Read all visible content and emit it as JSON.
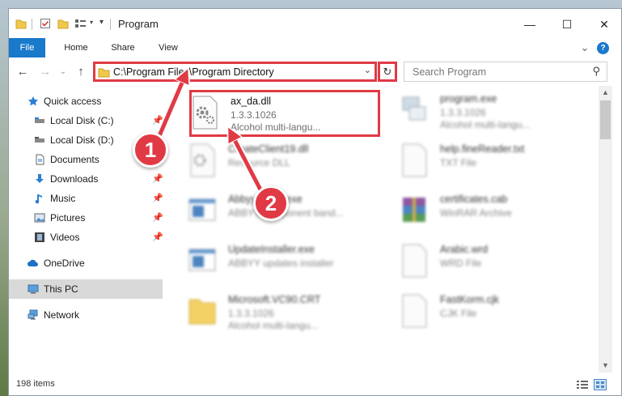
{
  "window": {
    "title": "Program",
    "minimize_glyph": "—",
    "maximize_glyph": "☐",
    "close_glyph": "✕"
  },
  "ribbon": {
    "tabs": [
      {
        "label": "File"
      },
      {
        "label": "Home"
      },
      {
        "label": "Share"
      },
      {
        "label": "View"
      }
    ],
    "expand_glyph": "⌄",
    "help_glyph": "?"
  },
  "nav": {
    "back_glyph": "←",
    "forward_glyph": "→",
    "recent_glyph": "⌄",
    "up_glyph": "↑"
  },
  "address": {
    "path": "C:\\Program Files\\Program Directory",
    "dropdown_glyph": "⌄",
    "refresh_glyph": "↻"
  },
  "search": {
    "placeholder": "Search Program",
    "icon_glyph": "⚲"
  },
  "sidebar": {
    "items": [
      {
        "label": "Quick access",
        "icon": "star-icon",
        "pinned": false
      },
      {
        "label": "Local Disk (C:)",
        "icon": "drive-icon",
        "pinned": true
      },
      {
        "label": "Local Disk (D:)",
        "icon": "drive-icon",
        "pinned": true
      },
      {
        "label": "Documents",
        "icon": "document-icon",
        "pinned": true
      },
      {
        "label": "Downloads",
        "icon": "download-icon",
        "pinned": true
      },
      {
        "label": "Music",
        "icon": "music-icon",
        "pinned": true
      },
      {
        "label": "Pictures",
        "icon": "pictures-icon",
        "pinned": true
      },
      {
        "label": "Videos",
        "icon": "video-icon",
        "pinned": true
      },
      {
        "label": "OneDrive",
        "icon": "cloud-icon",
        "pinned": false
      },
      {
        "label": "This PC",
        "icon": "computer-icon",
        "pinned": false,
        "selected": true
      },
      {
        "label": "Network",
        "icon": "network-icon",
        "pinned": false
      }
    ],
    "pin_glyph": "📌"
  },
  "files": [
    {
      "name": "ax_da.dll",
      "meta1": "1.3.3.1026",
      "meta2": "Alcohol multi-langu...",
      "icon": "dll-gear-icon",
      "highlighted": true
    },
    {
      "name": "program.exe",
      "meta1": "1.3.3.1026",
      "meta2": "Alcohol multi-langu...",
      "icon": "exe-icon"
    },
    {
      "name": "CreateClient19.dll",
      "meta1": "Resource DLL",
      "meta2": "",
      "icon": "dll-gear-icon"
    },
    {
      "name": "help.fineReader.txt",
      "meta1": "TXT File",
      "meta2": "",
      "icon": "text-file-icon"
    },
    {
      "name": "AbbyyComp.exe",
      "meta1": "ABBYY component band...",
      "meta2": "",
      "icon": "app-window-icon"
    },
    {
      "name": "certificates.cab",
      "meta1": "WinRAR Archive",
      "meta2": "",
      "icon": "winrar-icon"
    },
    {
      "name": "UpdateInstaller.exe",
      "meta1": "ABBYY updates installer",
      "meta2": "",
      "icon": "app-window-icon"
    },
    {
      "name": "Arabic.wrd",
      "meta1": "WRD File",
      "meta2": "",
      "icon": "blank-file-icon"
    },
    {
      "name": "Microsoft.VC90.CRT",
      "meta1": "1.3.3.1026",
      "meta2": "Alcohol multi-langu...",
      "icon": "folder-icon"
    },
    {
      "name": "FastKorm.cjk",
      "meta1": "CJK File",
      "meta2": "",
      "icon": "blank-file-icon"
    }
  ],
  "status": {
    "count": "198 items"
  },
  "annotations": {
    "step1": "1",
    "step2": "2"
  },
  "colors": {
    "accent": "#1979ca",
    "annotation": "#e03a45",
    "selected_nav": "#d9d9d9"
  }
}
